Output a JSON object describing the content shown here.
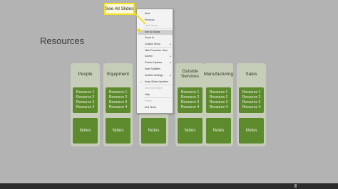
{
  "slide": {
    "title": "Resources",
    "columns": [
      {
        "label": "People",
        "resources": [
          "Resource 1",
          "Resource 2",
          "Resource 3",
          "Resource 4"
        ],
        "notes": "Notes"
      },
      {
        "label": "Equipment",
        "resources": [
          "Resource 1",
          "Resource 2",
          "Resource 3",
          "Resource 4"
        ],
        "notes": "Notes"
      },
      {
        "label": "",
        "resources": [
          "Resource 1",
          "Resource 2",
          "Resource 3",
          "Resource 4"
        ],
        "notes": "Notes"
      },
      {
        "label": "Outside Services",
        "resources": [
          "Resource 1",
          "Resource 2",
          "Resource 3",
          "Resource 4"
        ],
        "notes": "Notes"
      },
      {
        "label": "Manufacturing",
        "resources": [
          "Resource 1",
          "Resource 2",
          "Resource 3",
          "Resource 4"
        ],
        "notes": "Notes"
      },
      {
        "label": "Sales",
        "resources": [
          "Resource 1",
          "Resource 2",
          "Resource 3",
          "Resource 4"
        ],
        "notes": "Notes"
      }
    ]
  },
  "context_menu": {
    "items": [
      {
        "label": "Next",
        "disabled": false
      },
      {
        "label": "Previous",
        "disabled": false
      },
      {
        "label": "Last Viewed",
        "disabled": true
      },
      {
        "label": "See All Slides",
        "disabled": false,
        "highlight": true
      },
      {
        "label": "Zoom In",
        "disabled": false
      },
      {
        "label": "Custom Show",
        "disabled": false,
        "submenu": true
      },
      {
        "label": "Hide Presenter View",
        "disabled": false
      },
      {
        "label": "Screen",
        "disabled": false,
        "submenu": true
      },
      {
        "label": "Pointer Options",
        "disabled": false,
        "submenu": true
      },
      {
        "label": "Start Subtitles",
        "disabled": false
      },
      {
        "label": "Subtitle Settings",
        "disabled": false,
        "submenu": true
      },
      {
        "label": "Keep Slides Updated",
        "disabled": false,
        "checked": true
      },
      {
        "label": "Unrecord Slides",
        "disabled": true
      },
      {
        "label": "Help",
        "disabled": false
      },
      {
        "label": "Pause",
        "disabled": true
      },
      {
        "label": "End Show",
        "disabled": false
      }
    ]
  },
  "callout": {
    "label": "See All Slides"
  },
  "colors": {
    "slide_bg": "#b3b3b3",
    "column_bg": "#c6cdb8",
    "box_green": "#5d8a2c",
    "callout_border": "#f2e01c",
    "menu_bg": "#f3f3f3"
  },
  "icons": {
    "submenu": "chevron-right-icon",
    "check": "checkmark-icon"
  }
}
